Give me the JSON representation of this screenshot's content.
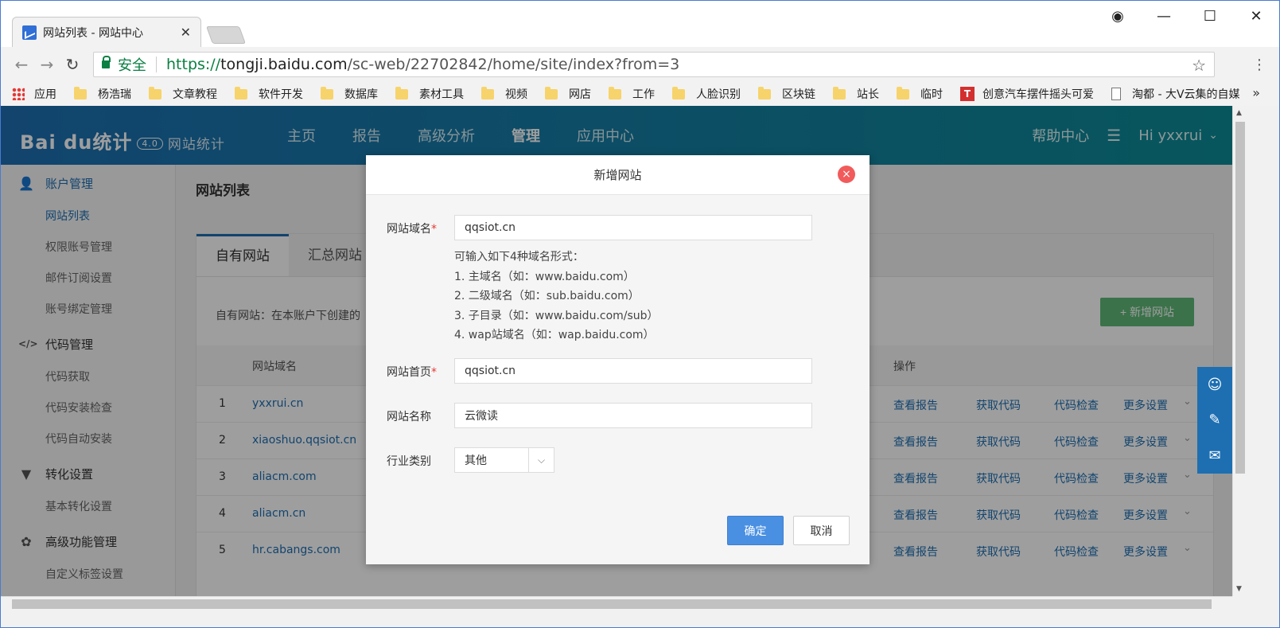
{
  "browser": {
    "tab_title": "网站列表 - 网站中心",
    "url_secure_label": "安全",
    "url_scheme": "https://",
    "url_host": "tongji.baidu.com",
    "url_path": "/sc-web/22702842/home/site/index?from=3",
    "bookmarks": [
      "应用",
      "杨浩瑞",
      "文章教程",
      "软件开发",
      "数据库",
      "素材工具",
      "视频",
      "网店",
      "工作",
      "人脸识别",
      "区块链",
      "站长",
      "临时",
      "创意汽车摆件摇头可爱",
      "淘都 - 大V云集的自媒"
    ],
    "bookmarks_more": "»"
  },
  "app": {
    "logo": "Bai du统计",
    "logo_badge": "4.0",
    "logo_sub": "网站统计",
    "nav": [
      "主页",
      "报告",
      "高级分析",
      "管理",
      "应用中心"
    ],
    "help": "帮助中心",
    "user": "Hi yxxrui"
  },
  "sidebar": {
    "groups": [
      {
        "label": "账户管理",
        "items": [
          "网站列表",
          "权限账号管理",
          "邮件订阅设置",
          "账号绑定管理"
        ]
      },
      {
        "label": "代码管理",
        "items": [
          "代码获取",
          "代码安装检查",
          "代码自动安装"
        ]
      },
      {
        "label": "转化设置",
        "items": [
          "基本转化设置"
        ]
      },
      {
        "label": "高级功能管理",
        "items": [
          "自定义标签设置"
        ]
      }
    ]
  },
  "content": {
    "title": "网站列表",
    "tabs": [
      "自有网站",
      "汇总网站"
    ],
    "desc": "自有网站：在本账户下创建的",
    "add_button": "+ 新增网站",
    "col_domain": "网站域名",
    "col_ops": "操作",
    "rows": [
      {
        "n": "1",
        "domain": "yxxrui.cn"
      },
      {
        "n": "2",
        "domain": "xiaoshuo.qqsiot.cn"
      },
      {
        "n": "3",
        "domain": "aliacm.com"
      },
      {
        "n": "4",
        "domain": "aliacm.cn"
      },
      {
        "n": "5",
        "domain": "hr.cabangs.com"
      }
    ],
    "actions": [
      "查看报告",
      "获取代码",
      "代码检查",
      "更多设置"
    ]
  },
  "modal": {
    "title": "新增网站",
    "domain_label": "网站域名",
    "domain_value": "qqsiot.cn",
    "hint": [
      "可输入如下4种域名形式：",
      "1. 主域名（如：www.baidu.com）",
      "2. 二级域名（如：sub.baidu.com）",
      "3. 子目录（如：www.baidu.com/sub）",
      "4. wap站域名（如：wap.baidu.com）"
    ],
    "home_label": "网站首页",
    "home_value": "qqsiot.cn",
    "name_label": "网站名称",
    "name_value": "云微读",
    "industry_label": "行业类别",
    "industry_value": "其他",
    "ok": "确定",
    "cancel": "取消",
    "required_mark": "*"
  }
}
